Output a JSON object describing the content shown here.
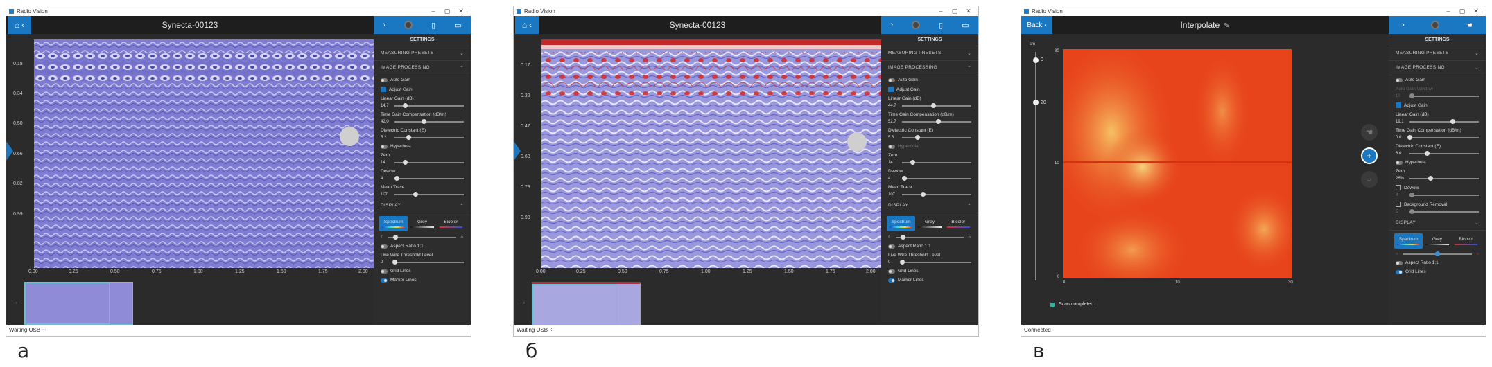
{
  "windows": [
    {
      "title": "Radio Vision",
      "header_title": "Synecta-00123",
      "y_ticks": [
        "0.18",
        "0.34",
        "0.50",
        "0.66",
        "0.82",
        "0.99"
      ],
      "x_ticks": [
        "0.00",
        "0.25",
        "0.50",
        "0.75",
        "1.00",
        "1.25",
        "1.50",
        "1.75",
        "2.00"
      ],
      "status": "Waiting USB",
      "caption": "а",
      "sidebar": {
        "settings": "SETTINGS",
        "measuring_presets": "MEASURING PRESETS",
        "image_processing": "IMAGE PROCESSING",
        "auto_gain": "Auto Gain",
        "adjust_gain": "Adjust Gain",
        "linear_gain_label": "Linear Gain (dB)",
        "linear_gain_value": "14.7",
        "tgc_label": "Time Gain Compensation (dB/m)",
        "tgc_value": "42.0",
        "dielectric_label": "Dielectric Constant (E)",
        "dielectric_value": "5.2",
        "hyperbola": "Hyperbola",
        "zero_label": "Zero",
        "zero_value": "14",
        "dewow_label": "Dewow",
        "dewow_value": "4",
        "mean_trace_label": "Mean Trace",
        "mean_trace_value": "107",
        "display": "DISPLAY",
        "modes": [
          "Spectrum",
          "Grey",
          "Bicolor"
        ],
        "aspect_ratio": "Aspect Ratio 1:1",
        "live_wire": "Live Wire Threshold Level",
        "live_wire_value": "0",
        "grid_lines": "Grid Lines",
        "marker_lines": "Marker Lines"
      }
    },
    {
      "title": "Radio Vision",
      "header_title": "Synecta-00123",
      "y_ticks": [
        "0.17",
        "0.32",
        "0.47",
        "0.63",
        "0.78",
        "0.93"
      ],
      "x_ticks": [
        "0.00",
        "0.25",
        "0.50",
        "0.75",
        "1.00",
        "1.25",
        "1.50",
        "1.75",
        "2.00"
      ],
      "status": "Waiting USB",
      "caption": "б",
      "sidebar": {
        "settings": "SETTINGS",
        "measuring_presets": "MEASURING PRESETS",
        "image_processing": "IMAGE PROCESSING",
        "auto_gain": "Auto Gain",
        "adjust_gain": "Adjust Gain",
        "linear_gain_label": "Linear Gain (dB)",
        "linear_gain_value": "44.7",
        "tgc_label": "Time Gain Compensation (dB/m)",
        "tgc_value": "52.7",
        "dielectric_label": "Dielectric Constant (E)",
        "dielectric_value": "5.6",
        "hyperbola": "Hyperbola",
        "zero_label": "Zero",
        "zero_value": "14",
        "dewow_label": "Dewow",
        "dewow_value": "4",
        "mean_trace_label": "Mean Trace",
        "mean_trace_value": "107",
        "display": "DISPLAY",
        "modes": [
          "Spectrum",
          "Grey",
          "Bicolor"
        ],
        "aspect_ratio": "Aspect Ratio 1:1",
        "live_wire": "Live Wire Threshold Level",
        "live_wire_value": "0",
        "grid_lines": "Grid Lines",
        "marker_lines": "Marker Lines"
      }
    },
    {
      "title": "Radio Vision",
      "back_label": "Back",
      "header_title": "Interpolate",
      "y_ticks": [
        "30",
        "10",
        "0"
      ],
      "x_ticks": [
        "0",
        "10",
        "30"
      ],
      "depth_unit": "cm",
      "depth_top": "0",
      "depth_bottom": "20",
      "scan_completed": "Scan completed",
      "status": "Connected",
      "caption": "в",
      "sidebar": {
        "settings": "SETTINGS",
        "measuring_presets": "MEASURING PRESETS",
        "image_processing": "IMAGE PROCESSING",
        "auto_gain": "Auto Gain",
        "auto_gain_window": "Auto Gain Window",
        "auto_gain_window_value": "10",
        "adjust_gain": "Adjust Gain",
        "linear_gain_label": "Linear Gain (dB)",
        "linear_gain_value": "19.1",
        "tgc_label": "Time Gain Compensation (dB/m)",
        "tgc_value": "0.0",
        "dielectric_label": "Dielectric Constant (E)",
        "dielectric_value": "6.0",
        "hyperbola": "Hyperbola",
        "zero_label": "Zero",
        "zero_value": "26%",
        "dewow_label": "Dewow",
        "dewow_value": "4",
        "background_removal": "Background Removal",
        "background_removal_value": "5",
        "display": "DISPLAY",
        "modes": [
          "Spectrum",
          "Grey",
          "Bicolor"
        ],
        "aspect_ratio": "Aspect Ratio 1:1",
        "grid_lines": "Grid Lines"
      }
    }
  ],
  "slider_levels": {
    "w0": {
      "linear_gain": 0.15,
      "tgc": 0.42,
      "dielectric": 0.2,
      "zero": 0.15,
      "dewow": 0.03,
      "mean_trace": 0.3,
      "palette": 0.1,
      "live_wire": 0.0
    },
    "w1": {
      "linear_gain": 0.45,
      "tgc": 0.52,
      "dielectric": 0.22,
      "zero": 0.15,
      "dewow": 0.03,
      "mean_trace": 0.3,
      "palette": 0.1,
      "live_wire": 0.0
    },
    "w2": {
      "linear_gain": 0.62,
      "tgc": 0.0,
      "dielectric": 0.25,
      "zero": 0.3,
      "dewow": 0.03,
      "background_removal": 0.03,
      "auto_gain_window": 0.03,
      "palette": 0.5
    }
  },
  "colors": {
    "accent": "#1a78c2",
    "radargram": "#7f7dd2",
    "heatmap_hot": "#e8401a",
    "heatmap_warm": "#f7b04a"
  }
}
